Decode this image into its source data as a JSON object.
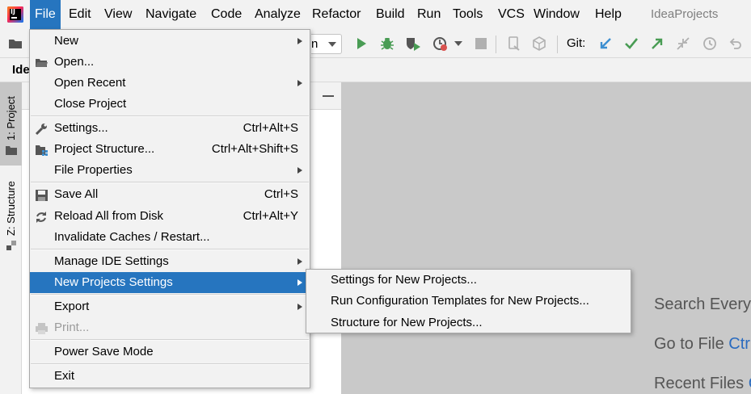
{
  "menubar": {
    "items": [
      "File",
      "Edit",
      "View",
      "Navigate",
      "Code",
      "Analyze",
      "Refactor",
      "Build",
      "Run",
      "Tools",
      "VCS",
      "Window",
      "Help"
    ],
    "window_title": "IdeaProjects"
  },
  "toolbar": {
    "run_config_text": "n",
    "git_label": "Git:"
  },
  "navbar": {
    "crumb": "Ide"
  },
  "left_strip": {
    "project_tab": "1: Project",
    "structure_tab": "Z: Structure"
  },
  "file_menu": {
    "items": [
      {
        "label": "New",
        "shortcut": "",
        "submenu": true,
        "icon": ""
      },
      {
        "label": "Open...",
        "shortcut": "",
        "submenu": false,
        "icon": "folder-icon"
      },
      {
        "label": "Open Recent",
        "shortcut": "",
        "submenu": true,
        "icon": ""
      },
      {
        "label": "Close Project",
        "shortcut": "",
        "submenu": false,
        "icon": ""
      },
      {
        "label": "Settings...",
        "shortcut": "Ctrl+Alt+S",
        "submenu": false,
        "icon": "wrench-icon"
      },
      {
        "label": "Project Structure...",
        "shortcut": "Ctrl+Alt+Shift+S",
        "submenu": false,
        "icon": "project-structure-icon"
      },
      {
        "label": "File Properties",
        "shortcut": "",
        "submenu": true,
        "icon": ""
      },
      {
        "label": "Save All",
        "shortcut": "Ctrl+S",
        "submenu": false,
        "icon": "save-icon"
      },
      {
        "label": "Reload All from Disk",
        "shortcut": "Ctrl+Alt+Y",
        "submenu": false,
        "icon": "reload-icon"
      },
      {
        "label": "Invalidate Caches / Restart...",
        "shortcut": "",
        "submenu": false,
        "icon": ""
      },
      {
        "label": "Manage IDE Settings",
        "shortcut": "",
        "submenu": true,
        "icon": ""
      },
      {
        "label": "New Projects Settings",
        "shortcut": "",
        "submenu": true,
        "icon": "",
        "highlighted": true
      },
      {
        "label": "Export",
        "shortcut": "",
        "submenu": true,
        "icon": ""
      },
      {
        "label": "Print...",
        "shortcut": "",
        "submenu": false,
        "icon": "print-icon",
        "disabled": true
      },
      {
        "label": "Power Save Mode",
        "shortcut": "",
        "submenu": false,
        "icon": ""
      },
      {
        "label": "Exit",
        "shortcut": "",
        "submenu": false,
        "icon": ""
      }
    ]
  },
  "submenu": {
    "items": [
      "Settings for New Projects...",
      "Run Configuration Templates for New Projects...",
      "Structure for New Projects..."
    ]
  },
  "editor_hints": [
    {
      "text": "Search Every",
      "shortcut": ""
    },
    {
      "text": "Go to File ",
      "shortcut": "Ctr"
    },
    {
      "text": "Recent Files ",
      "shortcut": "C"
    }
  ],
  "colors": {
    "accent": "#2675bf",
    "menu_bg": "#f2f2f2",
    "editor_bg": "#c9c9c9",
    "run_green": "#499c54"
  }
}
